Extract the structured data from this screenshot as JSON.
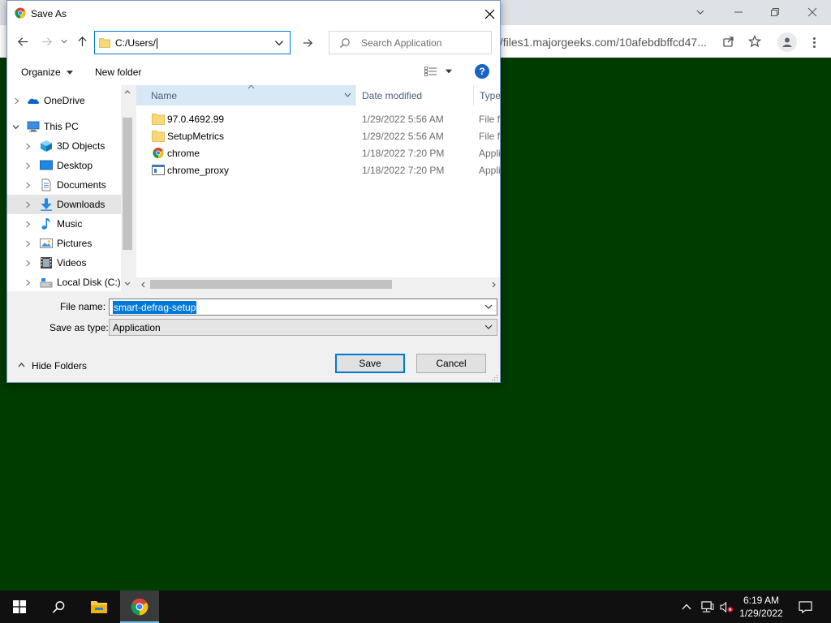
{
  "browser": {
    "url": "//files1.majorgeeks.com/10afebdbffcd47..."
  },
  "dialog": {
    "title": "Save As",
    "address": "C:/Users/",
    "search_placeholder": "Search Application",
    "toolbar": {
      "organize": "Organize",
      "new_folder": "New folder",
      "help": "?"
    },
    "nav_tree": [
      {
        "label": "OneDrive",
        "icon": "onedrive-icon"
      },
      {
        "label": "This PC",
        "icon": "computer-icon"
      },
      {
        "label": "3D Objects",
        "icon": "cube-icon"
      },
      {
        "label": "Desktop",
        "icon": "desktop-icon"
      },
      {
        "label": "Documents",
        "icon": "document-icon"
      },
      {
        "label": "Downloads",
        "icon": "download-icon"
      },
      {
        "label": "Music",
        "icon": "music-icon"
      },
      {
        "label": "Pictures",
        "icon": "picture-icon"
      },
      {
        "label": "Videos",
        "icon": "video-icon"
      },
      {
        "label": "Local Disk (C:)",
        "icon": "disk-icon"
      }
    ],
    "columns": {
      "name": "Name",
      "date": "Date modified",
      "type": "Type"
    },
    "files": [
      {
        "name": "97.0.4692.99",
        "date": "1/29/2022 5:56 AM",
        "type": "File fo",
        "icon": "folder-icon"
      },
      {
        "name": "SetupMetrics",
        "date": "1/29/2022 5:56 AM",
        "type": "File fo",
        "icon": "folder-icon"
      },
      {
        "name": "chrome",
        "date": "1/18/2022 7:20 PM",
        "type": "Appli",
        "icon": "chrome-icon"
      },
      {
        "name": "chrome_proxy",
        "date": "1/18/2022 7:20 PM",
        "type": "Appli",
        "icon": "app-window-icon"
      }
    ],
    "file_name_label": "File name:",
    "file_name_value": "smart-defrag-setup",
    "save_type_label": "Save as type:",
    "save_type_value": "Application",
    "hide_folders": "Hide Folders",
    "save_button": "Save",
    "cancel_button": "Cancel"
  },
  "taskbar": {
    "time": "6:19 AM",
    "date": "1/29/2022"
  },
  "colors": {
    "desktop_bg": "#003c00",
    "accent": "#0078d7",
    "folder": "#f8d775"
  }
}
